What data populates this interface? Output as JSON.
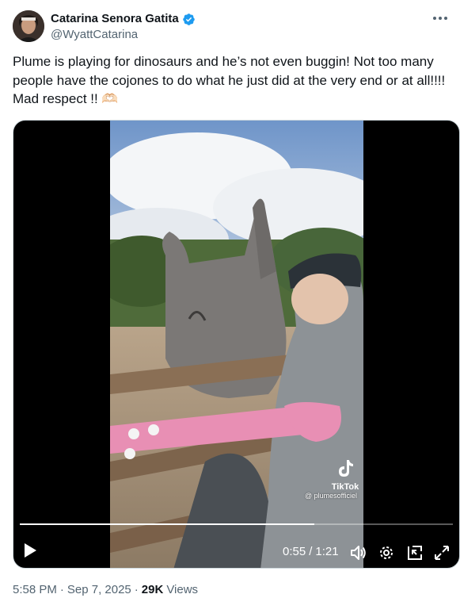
{
  "author": {
    "name": "Catarina Senora Gatita",
    "handle": "@WyattCatarina",
    "verified_color": "#1d9bf0"
  },
  "tweet": {
    "text": "Plume is playing for dinosaurs and he’s not even buggin! Not too many people have the cojones to do what he just did at the very end or at all!!!! Mad respect !! 🫶🏻"
  },
  "video": {
    "current_time": "0:55",
    "separator": "/",
    "duration": "1:21",
    "progress": 0.68,
    "watermark_name": "TikTok",
    "watermark_handle": "@ plumesofficiel"
  },
  "footer": {
    "time": "5:58 PM",
    "dot1": "·",
    "date": "Sep 7, 2025",
    "dot2": "·",
    "views_count": "29K",
    "views_label": "Views"
  },
  "icons": {
    "more": "more-icon",
    "play": "play-icon",
    "volume": "volume-icon",
    "settings": "gear-icon",
    "pip": "picture-in-picture-icon",
    "fullscreen": "fullscreen-icon"
  }
}
